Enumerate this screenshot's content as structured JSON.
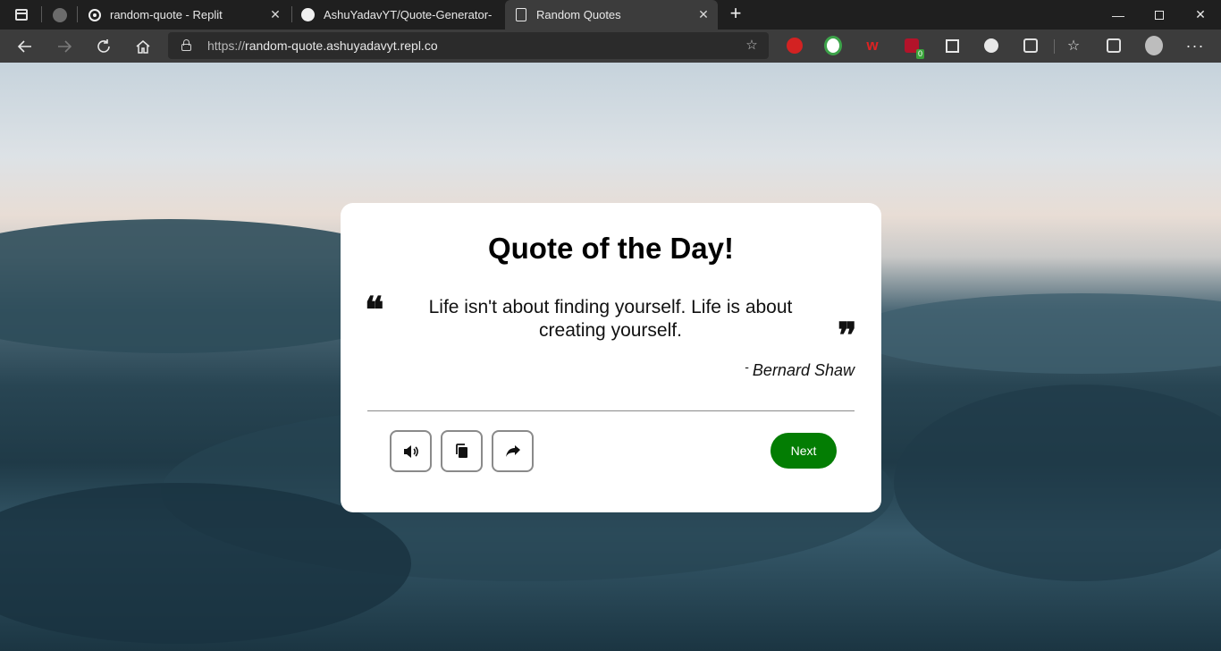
{
  "browser": {
    "tabs": [
      {
        "title": "random-quote - Replit",
        "favicon": "replit-icon"
      },
      {
        "title": "AshuYadavYT/Quote-Generator-",
        "favicon": "github-icon"
      },
      {
        "title": "Random Quotes",
        "favicon": "document-icon"
      }
    ],
    "new_tab_label": "+",
    "close_glyph": "✕",
    "url_scheme": "https://",
    "url_host": "random-quote.ashuyadavyt.repl.co",
    "extension_badge": "0",
    "window_controls": {
      "minimize": "—",
      "maximize": "",
      "close": "✕"
    }
  },
  "page": {
    "title": "Quote of the Day!",
    "quote": "Life isn't about finding yourself. Life is about creating yourself.",
    "author": "Bernard Shaw",
    "author_dash": "-",
    "open_quote_mark": "❝",
    "close_quote_mark": "❞",
    "buttons": {
      "speak": "speaker-icon",
      "copy": "copy-icon",
      "share": "share-icon",
      "next": "Next"
    },
    "colors": {
      "next_button": "#037d03",
      "card_background": "#ffffff"
    }
  }
}
